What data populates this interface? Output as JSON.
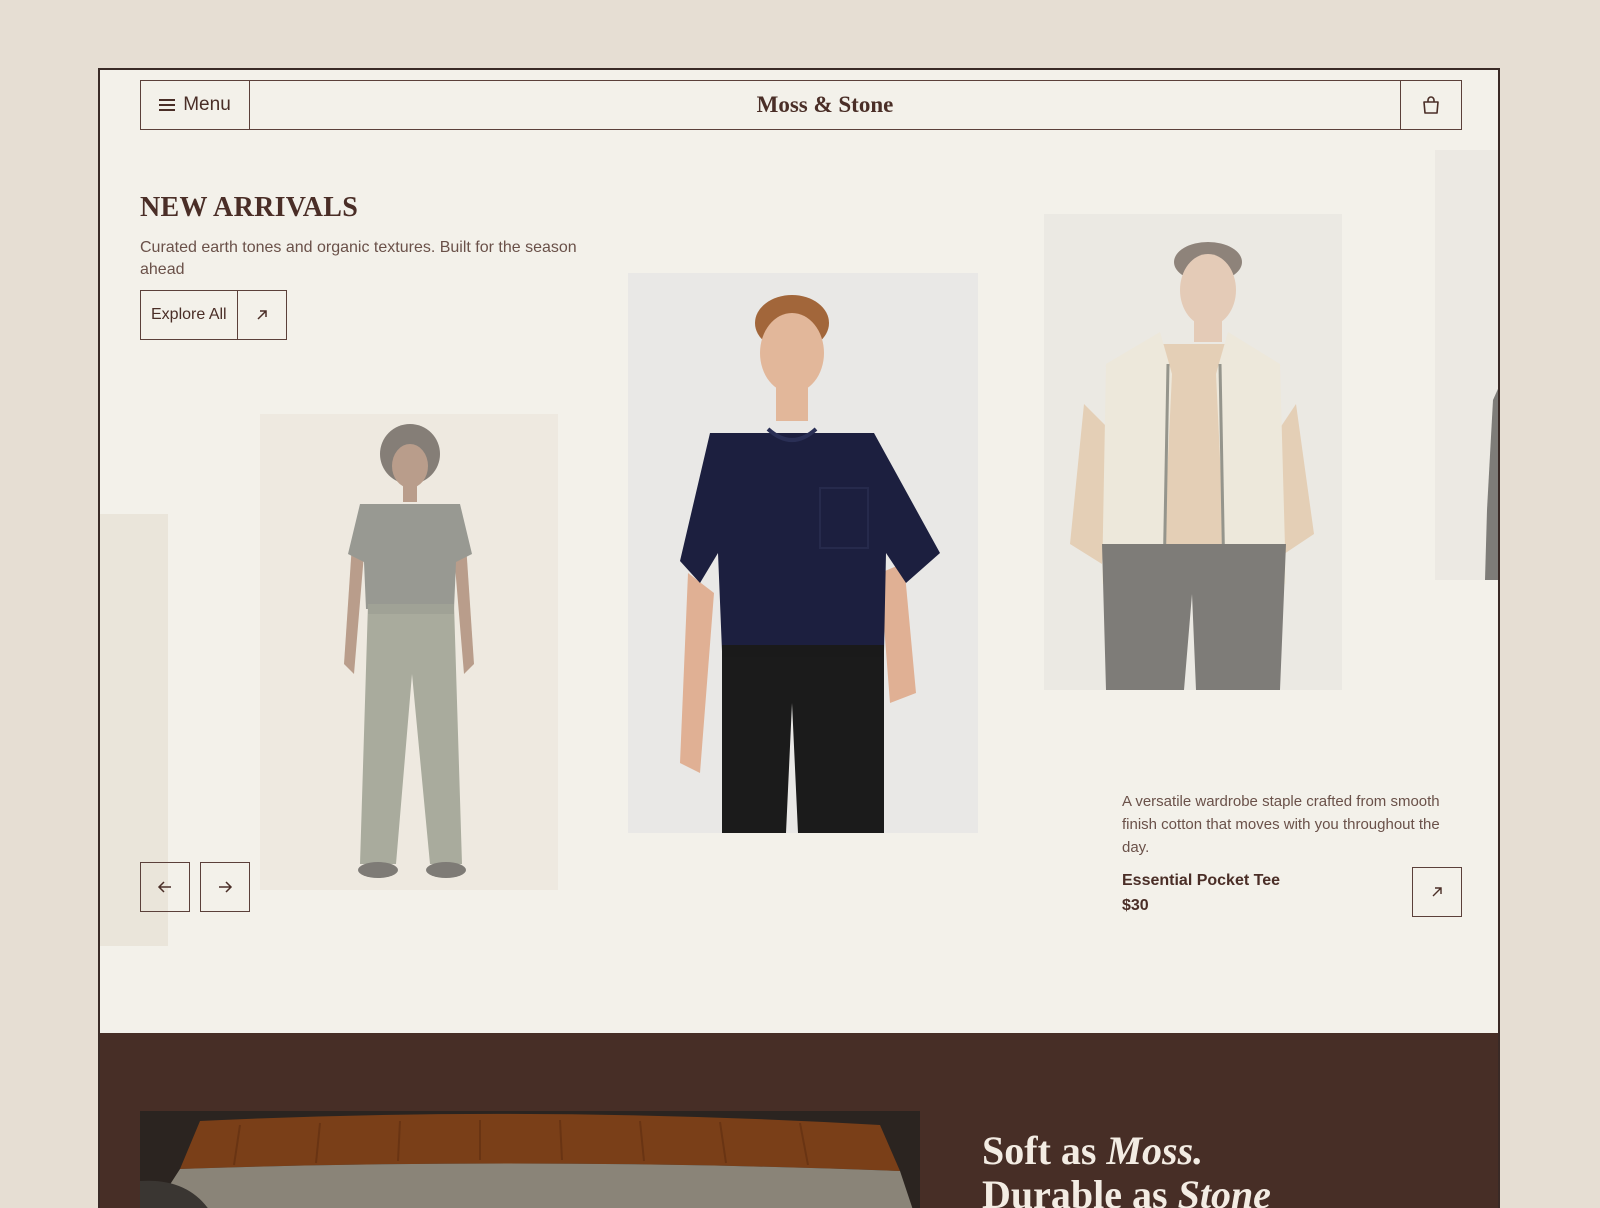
{
  "header": {
    "menu_label": "Menu",
    "brand": "Moss & Stone",
    "cart_icon": "shopping-bag-icon"
  },
  "hero": {
    "title": "NEW ARRIVALS",
    "subtitle": "Curated earth tones and organic textures. Built for the season ahead",
    "explore_label": "Explore All"
  },
  "featured": {
    "description": "A versatile wardrobe staple crafted from smooth finish cotton that moves with you throughout the day.",
    "name": "Essential Pocket Tee",
    "price": "$30"
  },
  "carousel": {
    "prev_icon": "arrow-left-icon",
    "next_icon": "arrow-right-icon"
  },
  "promo": {
    "line1_plain": "Soft as ",
    "line1_italic": "Moss.",
    "line2_plain": "Durable as ",
    "line2_italic": "Stone"
  },
  "colors": {
    "page_background": "#e6ded3",
    "content_background": "#f3f1ea",
    "brand_brown": "#4a2e27",
    "section_brown": "#472e26"
  }
}
